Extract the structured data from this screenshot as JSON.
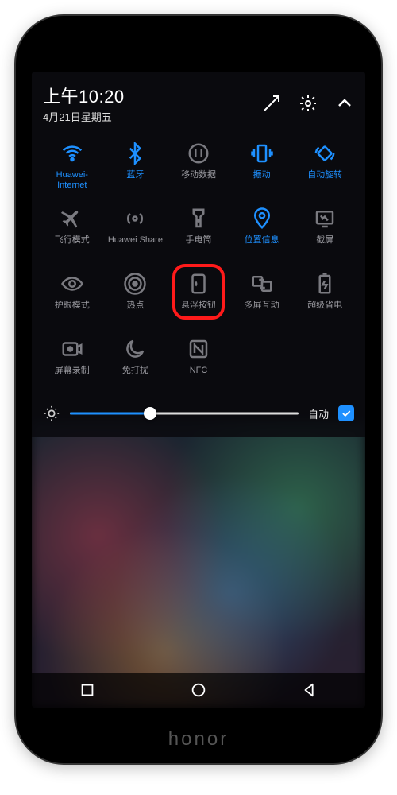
{
  "status": {
    "time": "上午10:20",
    "date": "4月21日星期五"
  },
  "brightness": {
    "auto_label": "自动",
    "auto_checked": true,
    "value_percent": 35
  },
  "tiles": [
    {
      "id": "wifi",
      "label": "Huawei-\nInternet",
      "active": true
    },
    {
      "id": "bluetooth",
      "label": "蓝牙",
      "active": true
    },
    {
      "id": "mobile-data",
      "label": "移动数据",
      "active": false
    },
    {
      "id": "vibrate",
      "label": "振动",
      "active": true
    },
    {
      "id": "auto-rotate",
      "label": "自动旋转",
      "active": true
    },
    {
      "id": "airplane",
      "label": "飞行模式",
      "active": false
    },
    {
      "id": "huawei-share",
      "label": "Huawei Share",
      "active": false
    },
    {
      "id": "flashlight",
      "label": "手电筒",
      "active": false
    },
    {
      "id": "location",
      "label": "位置信息",
      "active": true
    },
    {
      "id": "screenshot",
      "label": "截屏",
      "active": false
    },
    {
      "id": "eye-comfort",
      "label": "护眼模式",
      "active": false
    },
    {
      "id": "hotspot",
      "label": "热点",
      "active": false
    },
    {
      "id": "floating-dock",
      "label": "悬浮按钮",
      "active": false,
      "highlighted": true
    },
    {
      "id": "multi-screen",
      "label": "多屏互动",
      "active": false
    },
    {
      "id": "ultra-power-save",
      "label": "超级省电",
      "active": false
    },
    {
      "id": "screen-record",
      "label": "屏幕录制",
      "active": false
    },
    {
      "id": "do-not-disturb",
      "label": "免打扰",
      "active": false
    },
    {
      "id": "nfc",
      "label": "NFC",
      "active": false
    }
  ],
  "brand": "honor"
}
